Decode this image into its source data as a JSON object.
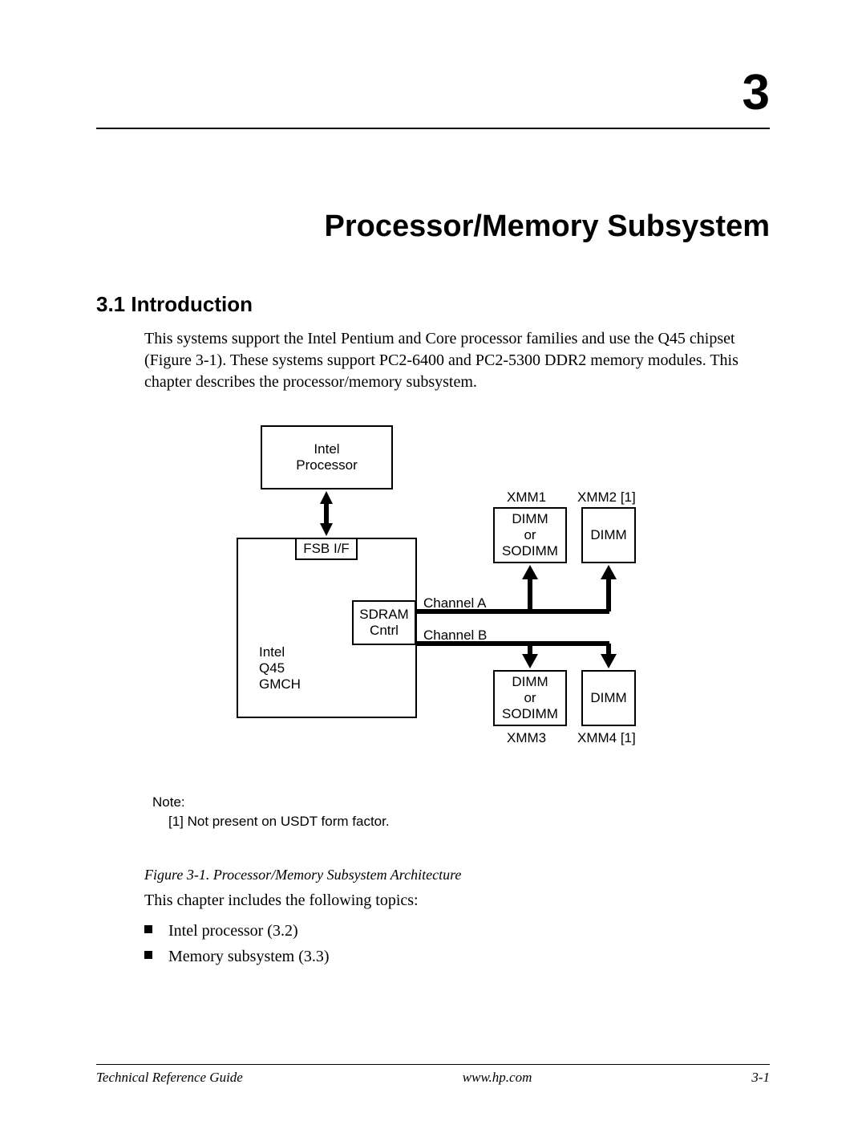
{
  "chapter": {
    "number": "3",
    "title": "Processor/Memory Subsystem"
  },
  "section": {
    "number": "3.1",
    "title": "Introduction",
    "heading": "3.1   Introduction",
    "body": "This systems support the Intel Pentium and Core processor families and use the Q45 chipset (Figure 3-1). These systems support PC2-6400 and PC2-5300 DDR2 memory modules. This chapter describes the processor/memory subsystem."
  },
  "diagram": {
    "processor_box": {
      "line1": "Intel",
      "line2": "Processor"
    },
    "gmch_box": {
      "line1": "Intel",
      "line2": "Q45",
      "line3": "GMCH"
    },
    "fsb_box": "FSB I/F",
    "sdram_box": {
      "line1": "SDRAM",
      "line2": "Cntrl"
    },
    "dimm_or_sodimm": {
      "line1": "DIMM",
      "line2": "or",
      "line3": "SODIMM"
    },
    "dimm": "DIMM",
    "channel_a": "Channel A",
    "channel_b": "Channel B",
    "xmm1": "XMM1",
    "xmm2": "XMM2 [1]",
    "xmm3": "XMM3",
    "xmm4": "XMM4 [1]",
    "note_label": "Note:",
    "note_text": "[1] Not present on USDT form factor."
  },
  "figure": {
    "caption": "Figure 3-1.   Processor/Memory Subsystem Architecture"
  },
  "topics": {
    "intro": "This chapter includes the following topics:",
    "items": [
      "Intel processor (3.2)",
      "Memory subsystem (3.3)"
    ]
  },
  "footer": {
    "left": "Technical Reference Guide",
    "center": "www.hp.com",
    "right": "3-1"
  }
}
